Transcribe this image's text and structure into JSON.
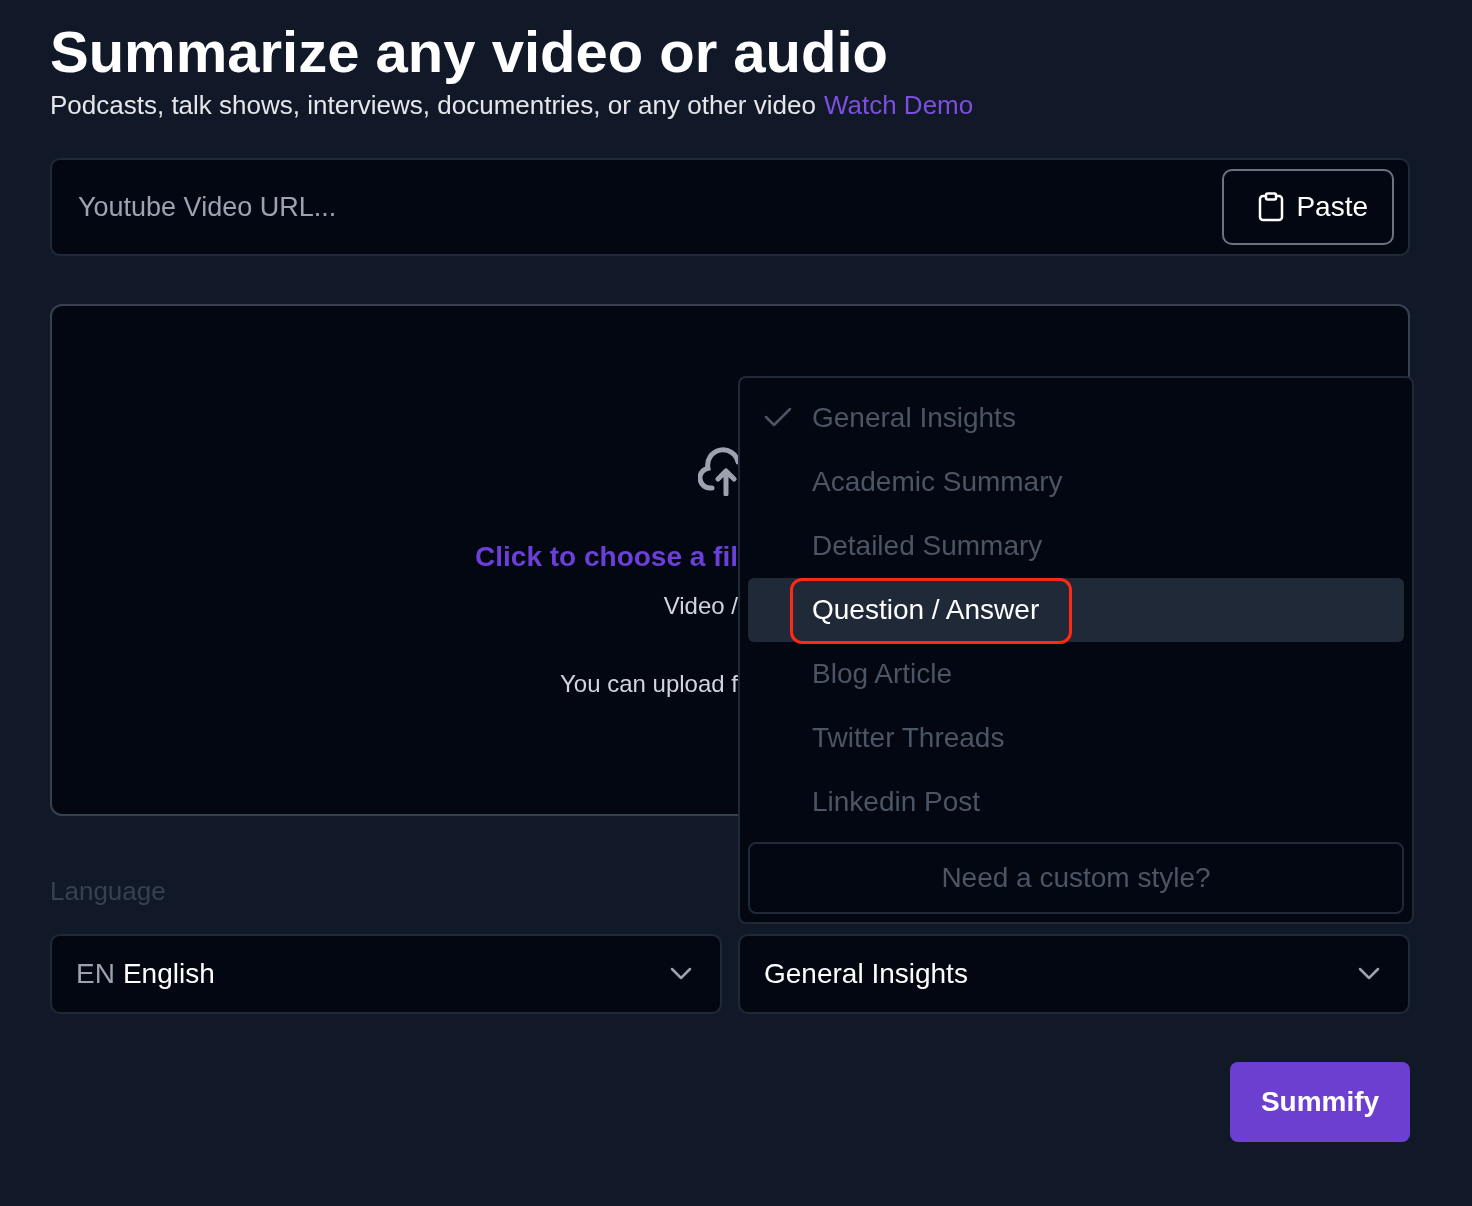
{
  "header": {
    "title": "Summarize any video or audio",
    "subtitle": "Podcasts, talk shows, interviews, documentries, or any other video",
    "demo_link": "Watch Demo"
  },
  "url_field": {
    "placeholder": "Youtube Video URL...",
    "paste_button": "Paste"
  },
  "upload": {
    "action": "Click to choose a fil",
    "types": "Video /",
    "note": "You can upload f"
  },
  "language": {
    "label": "Language",
    "code": "EN",
    "value": "English"
  },
  "style_select": {
    "value": "General Insights",
    "menu": [
      {
        "label": "General Insights",
        "checked": true,
        "highlighted": false,
        "circled": false
      },
      {
        "label": "Academic Summary",
        "checked": false,
        "highlighted": false,
        "circled": false
      },
      {
        "label": "Detailed Summary",
        "checked": false,
        "highlighted": false,
        "circled": false
      },
      {
        "label": "Question / Answer",
        "checked": false,
        "highlighted": true,
        "circled": true
      },
      {
        "label": "Blog Article",
        "checked": false,
        "highlighted": false,
        "circled": false
      },
      {
        "label": "Twitter Threads",
        "checked": false,
        "highlighted": false,
        "circled": false
      },
      {
        "label": "Linkedin Post",
        "checked": false,
        "highlighted": false,
        "circled": false
      }
    ],
    "custom_button": "Need a custom style?"
  },
  "submit_button": "Summify"
}
